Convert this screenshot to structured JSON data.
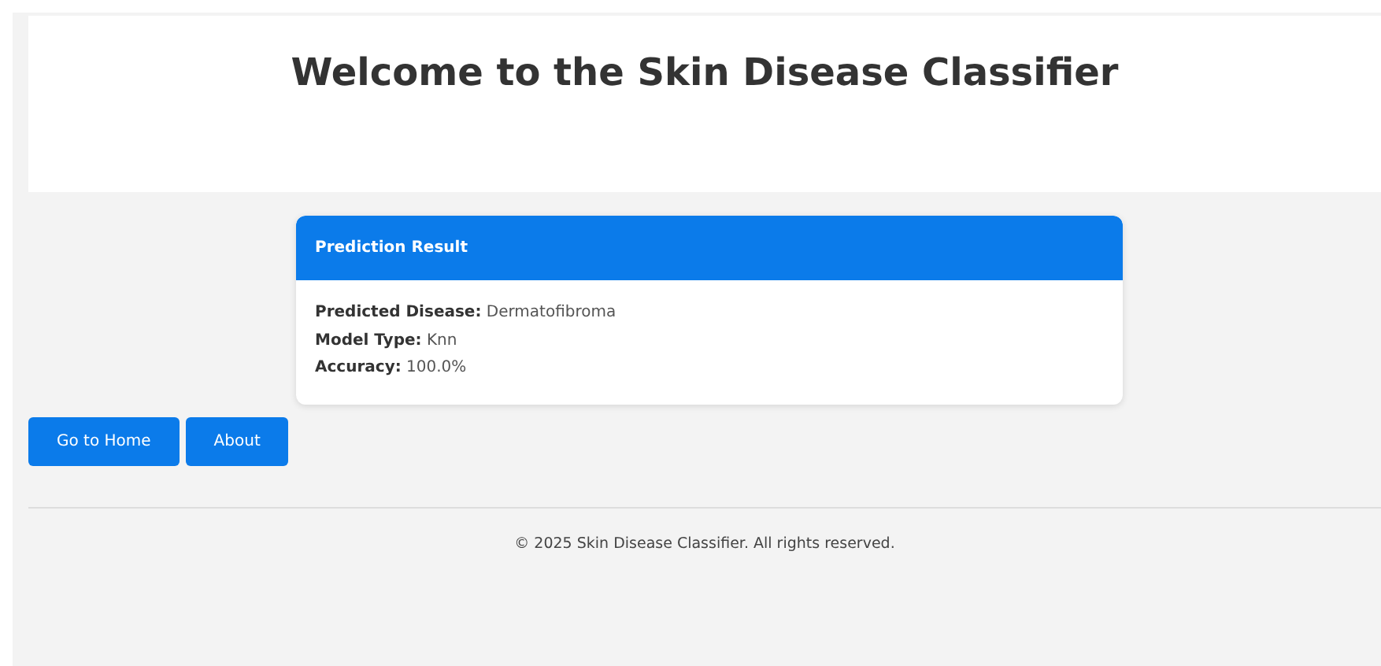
{
  "header": {
    "title": "Welcome to the Skin Disease Classifier"
  },
  "result_card": {
    "title": "Prediction Result",
    "fields": [
      {
        "label": "Predicted Disease:",
        "value": "Dermatofibroma"
      },
      {
        "label": "Model Type:",
        "value": "Knn"
      },
      {
        "label": "Accuracy:",
        "value": "100.0%"
      }
    ]
  },
  "buttons": [
    "Go to Home",
    "About"
  ],
  "footer": {
    "text": "© 2025 Skin Disease Classifier. All rights reserved."
  }
}
